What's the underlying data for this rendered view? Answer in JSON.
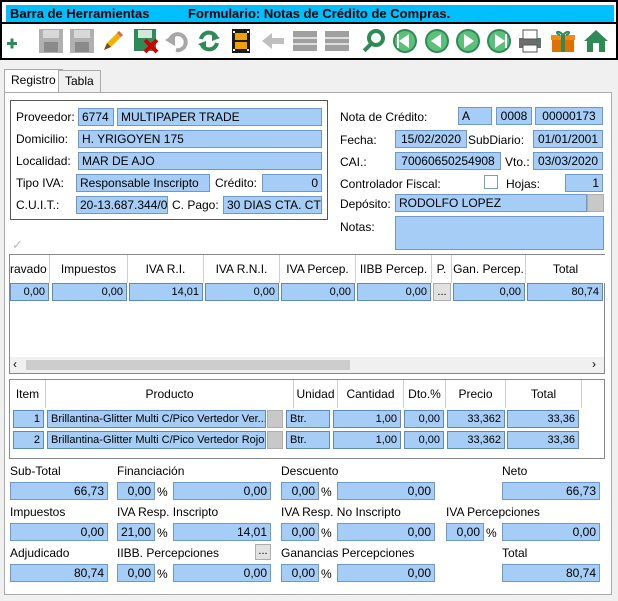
{
  "window": {
    "title": "Barra de Herramientas",
    "form_title": "Formulario: Notas de Crédito de Compras."
  },
  "tabs": [
    {
      "label": "Registro"
    },
    {
      "label": "Tabla"
    }
  ],
  "header": {
    "proveedor_label": "Proveedor:",
    "proveedor_code": "6774",
    "proveedor_name": "MULTIPAPER TRADE",
    "domicilio_label": "Domicilio:",
    "domicilio": "H. YRIGOYEN 175",
    "localidad_label": "Localidad:",
    "localidad": "MAR DE AJO",
    "tipo_iva_label": "Tipo IVA:",
    "tipo_iva": "Responsable Inscripto",
    "credito_label": "Crédito:",
    "credito": "0",
    "cuit_label": "C.U.I.T.:",
    "cuit": "20-13.687.344/0",
    "cpago_label": "C. Pago:",
    "cpago": "30 DIAS CTA. CT",
    "nota_label": "Nota de Crédito:",
    "nota_letra": "A",
    "nota_pv": "0008",
    "nota_num": "00000173",
    "fecha_label": "Fecha:",
    "fecha": "15/02/2020",
    "subdiario_label": "SubDiario:",
    "subdiario": "01/01/2001",
    "cai_label": "CAI.:",
    "cai": "70060650254908",
    "vto_label": "Vto.:",
    "vto": "03/03/2020",
    "controlador_label": "Controlador Fiscal:",
    "hojas_label": "Hojas:",
    "hojas": "1",
    "deposito_label": "Depósito:",
    "deposito": "RODOLFO LOPEZ",
    "notas_label": "Notas:",
    "notas": ""
  },
  "tax_grid": {
    "headers": [
      "ravado",
      "Impuestos",
      "IVA R.I.",
      "IVA R.N.I.",
      "IVA Percep.",
      "IIBB Percep.",
      "P.",
      "Gan. Percep.",
      "Total"
    ],
    "row": [
      "0,00",
      "0,00",
      "14,01",
      "0,00",
      "0,00",
      "0,00",
      "...",
      "0,00",
      "80,74"
    ]
  },
  "items_grid": {
    "headers": [
      "Item",
      "Producto",
      "Unidad",
      "Cantidad",
      "Dto.%",
      "Precio",
      "Total"
    ],
    "rows": [
      [
        "1",
        "Brillantina-Glitter Multi C/Pico Vertedor Ver...",
        "Btr.",
        "1,00",
        "0,00",
        "33,362",
        "33,36"
      ],
      [
        "2",
        "Brillantina-Glitter Multi C/Pico Vertedor Rojo",
        "Btr.",
        "1,00",
        "0,00",
        "33,362",
        "33,36"
      ]
    ]
  },
  "totals": {
    "subtotal_label": "Sub-Total",
    "subtotal": "66,73",
    "financiacion_label": "Financiación",
    "financiacion_pct": "0,00",
    "financiacion": "0,00",
    "descuento_label": "Descuento",
    "descuento_pct": "0,00",
    "descuento": "0,00",
    "neto_label": "Neto",
    "neto": "66,73",
    "impuestos_label": "Impuestos",
    "impuestos": "0,00",
    "iva_ri_label": "IVA Resp. Inscripto",
    "iva_ri_pct": "21,00",
    "iva_ri": "14,01",
    "iva_rni_label": "IVA Resp. No Inscripto",
    "iva_rni_pct": "0,00",
    "iva_rni": "0,00",
    "iva_perc_label": "IVA Percepciones",
    "iva_perc_pct": "0,00",
    "iva_perc": "0,00",
    "adjudicado_label": "Adjudicado",
    "adjudicado": "80,74",
    "iibb_label": "IIBB. Percepciones",
    "iibb_pct": "0,00",
    "iibb": "0,00",
    "iibb_btn": "...",
    "gan_label": "Ganancias Percepciones",
    "gan_pct": "0,00",
    "gan": "0,00",
    "total_label": "Total",
    "total": "80,74",
    "pct_sign": "%"
  },
  "toolbar_icons": [
    "add-icon",
    "save-icon",
    "save-as-icon",
    "edit-icon",
    "delete-icon",
    "undo-icon",
    "refresh-icon",
    "film-icon",
    "back-arrow-icon",
    "grid-icon",
    "grid2-icon",
    "search-icon",
    "first-icon",
    "prev-icon",
    "next-icon",
    "last-icon",
    "print-icon",
    "gift-icon",
    "home-icon"
  ]
}
